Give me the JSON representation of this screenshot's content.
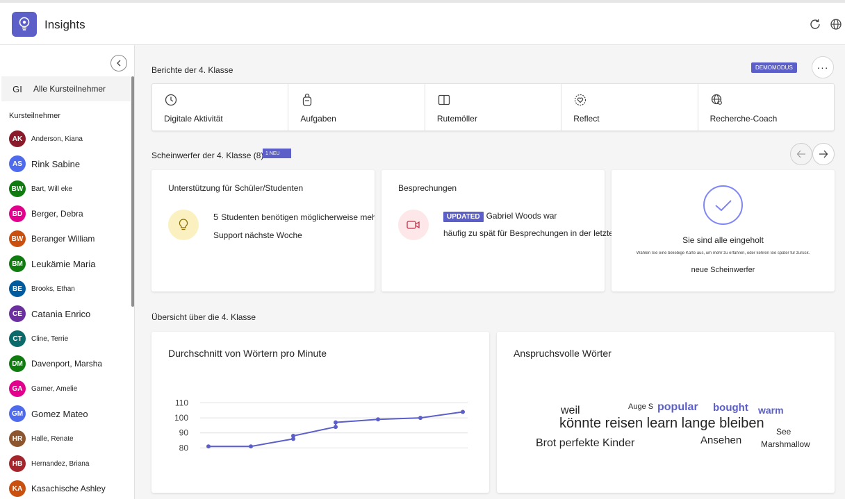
{
  "app": {
    "title": "Insights",
    "accent": "#5b5fc7"
  },
  "header_icons": [
    "refresh-icon",
    "globe-icon"
  ],
  "sidebar": {
    "all_item": {
      "initials": "GI",
      "label": "Alle Kursteilnehmer"
    },
    "section_label": "Kursteilnehmer",
    "students": [
      {
        "initials": "AK",
        "name": "Anderson, Kiana",
        "color": "#8b1a2b",
        "size": "s"
      },
      {
        "initials": "AS",
        "name": "Rink Sabine",
        "color": "#4f6bed",
        "size": "l"
      },
      {
        "initials": "BW",
        "name": "Bart, Will eke",
        "color": "#107c10",
        "size": "s"
      },
      {
        "initials": "BD",
        "name": "Berger, Debra",
        "color": "#e3008c",
        "size": "m"
      },
      {
        "initials": "BW",
        "name": "Beranger William",
        "color": "#ca5010",
        "size": "m"
      },
      {
        "initials": "BM",
        "name": "Leukämie Maria",
        "color": "#107c10",
        "size": "l"
      },
      {
        "initials": "BE",
        "name": "Brooks, Ethan",
        "color": "#005b9f",
        "size": "s"
      },
      {
        "initials": "CE",
        "name": "Catania Enrico",
        "color": "#6b2fa0",
        "size": "l"
      },
      {
        "initials": "CT",
        "name": "Cline, Terrie",
        "color": "#0b6a6a",
        "size": "s"
      },
      {
        "initials": "DM",
        "name": "Davenport, Marsha",
        "color": "#107c10",
        "size": "m"
      },
      {
        "initials": "GA",
        "name": "Garner, Amelie",
        "color": "#e3008c",
        "size": "s"
      },
      {
        "initials": "GM",
        "name": "Gomez Mateo",
        "color": "#4f6bed",
        "size": "l"
      },
      {
        "initials": "HR",
        "name": "Halle, Renate",
        "color": "#8e562e",
        "size": "s"
      },
      {
        "initials": "HB",
        "name": "Hernandez, Briana",
        "color": "#a4262c",
        "size": "s"
      },
      {
        "initials": "KA",
        "name": "Kasachische Ashley",
        "color": "#ca5010",
        "size": "m"
      }
    ]
  },
  "main": {
    "reports_title": "Berichte der 4. Klasse",
    "demo_badge": "DEMOMODUS",
    "more_label": "···",
    "reports": [
      {
        "label": "Digitale Aktivität",
        "icon": "clock-icon"
      },
      {
        "label": "Aufgaben",
        "icon": "backpack-icon"
      },
      {
        "label": "Rutemöller",
        "icon": "book-icon"
      },
      {
        "label": "Reflect",
        "icon": "heart-icon"
      },
      {
        "label": "Recherche-Coach",
        "icon": "globe-search-icon"
      }
    ],
    "spotlight_title": "Scheinwerfer der 4. Klasse (8)",
    "new_badge": "1 NEU",
    "spotlights": {
      "support": {
        "title": "Unterstützung für Schüler/Studenten",
        "count": "5",
        "line1": "Studenten benötigen möglicherweise mehr",
        "line2": "Support nächste Woche"
      },
      "meetings": {
        "title": "Besprechungen",
        "tag": "UPDATED",
        "line1": "Gabriel Woods war",
        "line2": "häufig zu spät für Besprechungen in der letzten Woche"
      },
      "caught_up": {
        "title": "Sie sind alle eingeholt",
        "hint": "Wählen Sie eine beliebige Karte aus, um mehr zu erfahren, oder kehren Sie später für zurück.",
        "footer": "neue Scheinwerfer"
      }
    },
    "overview_title": "Übersicht über die 4. Klasse",
    "wpm_card": {
      "title": "Durchschnitt von Wörtern pro Minute"
    },
    "words_card": {
      "title": "Anspruchsvolle Wörter",
      "words": [
        {
          "text": "weil",
          "size": 16,
          "color": "#242424",
          "bold": false
        },
        {
          "text": "Auge S",
          "size": 11,
          "color": "#242424",
          "bold": false
        },
        {
          "text": "popular",
          "size": 16,
          "color": "#5b5fc7",
          "bold": true
        },
        {
          "text": "bought",
          "size": 15,
          "color": "#5b5fc7",
          "bold": true
        },
        {
          "text": "warm",
          "size": 14,
          "color": "#5b5fc7",
          "bold": true
        },
        {
          "text": "könnte reisen learn lange bleiben",
          "size": 20,
          "color": "#242424",
          "bold": false
        },
        {
          "text": "See",
          "size": 12,
          "color": "#242424",
          "bold": false
        },
        {
          "text": "Brot perfekte Kinder",
          "size": 16,
          "color": "#242424",
          "bold": false
        },
        {
          "text": "Ansehen",
          "size": 15,
          "color": "#242424",
          "bold": false
        },
        {
          "text": "Marshmallow",
          "size": 12,
          "color": "#242424",
          "bold": false
        }
      ]
    }
  },
  "chart_data": {
    "type": "line",
    "title": "Durchschnitt von Wörtern pro Minute",
    "xlabel": "",
    "ylabel": "",
    "yticks": [
      80,
      90,
      100,
      110
    ],
    "ylim": [
      76,
      113
    ],
    "grid": true,
    "color": "#5b5fc7",
    "x": [
      1,
      2,
      3,
      3,
      4,
      4,
      5,
      6,
      7
    ],
    "values": [
      81,
      81,
      86,
      88,
      94,
      97,
      99,
      100,
      104
    ]
  }
}
